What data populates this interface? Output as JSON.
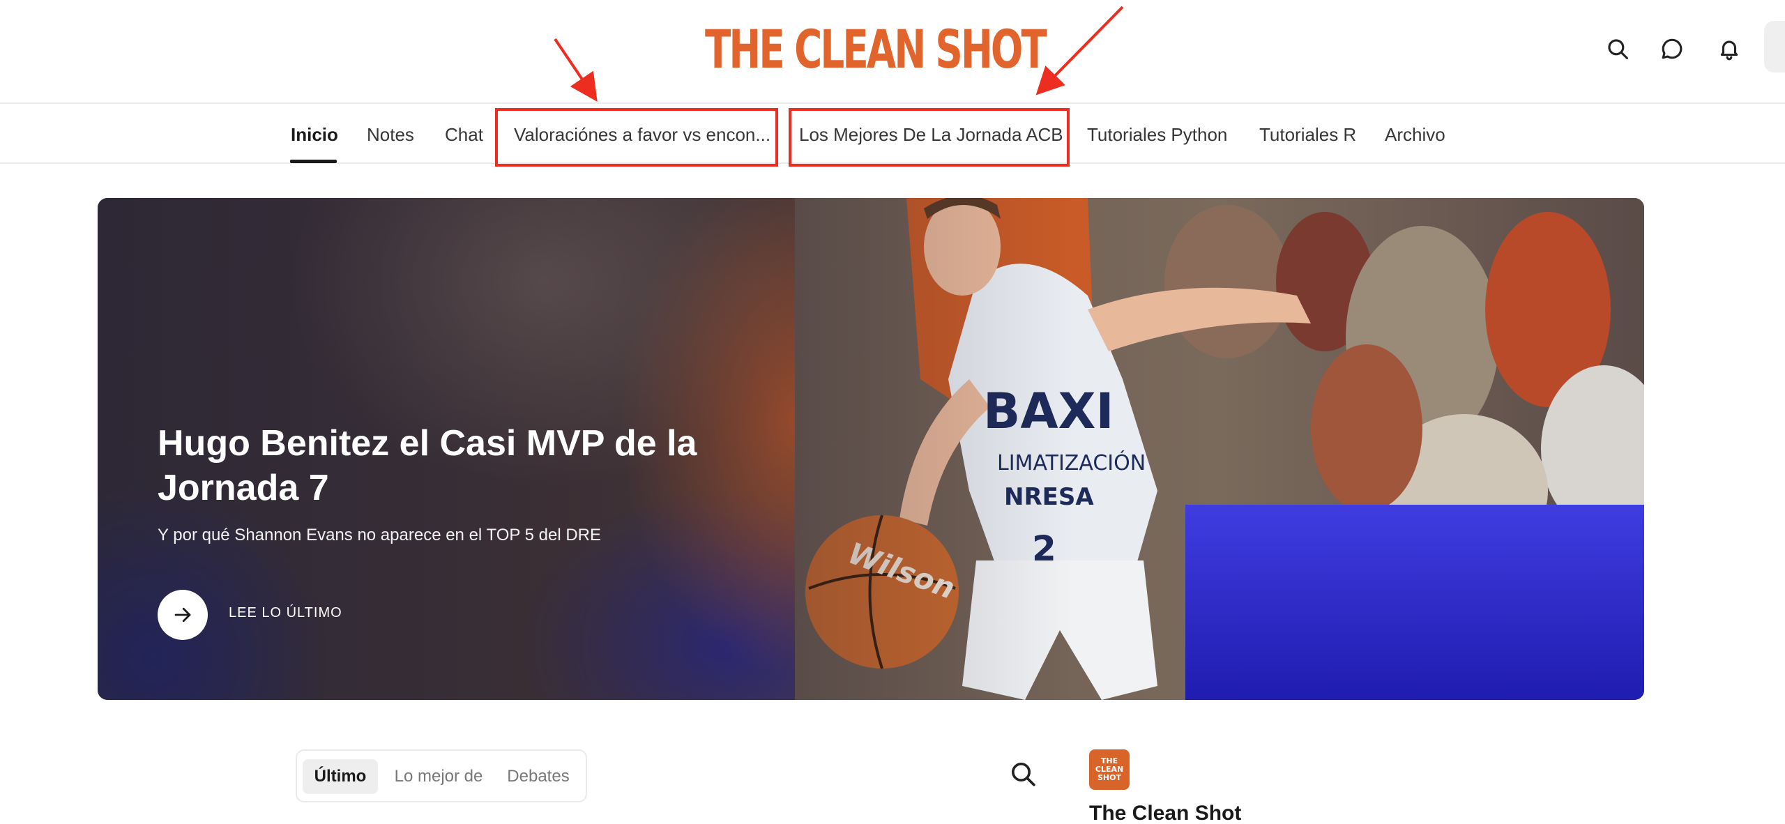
{
  "header": {
    "logo_text": "THE CLEAN SHOT",
    "icons": [
      "search-icon",
      "chat-bubble-icon",
      "bell-icon"
    ]
  },
  "nav": {
    "items": [
      {
        "label": "Inicio",
        "active": true
      },
      {
        "label": "Notes"
      },
      {
        "label": "Chat"
      },
      {
        "label": "Valoraciónes a favor vs encon..."
      },
      {
        "label": "Los Mejores De La Jornada ACB"
      },
      {
        "label": "Tutoriales Python"
      },
      {
        "label": "Tutoriales R"
      },
      {
        "label": "Archivo"
      }
    ]
  },
  "hero": {
    "title": "Hugo Benitez el Casi MVP de la Jornada 7",
    "subtitle": "Y por qué Shannon Evans no aparece en el TOP 5 del DRE",
    "cta_label": "LEE LO ÚLTIMO",
    "cta_icon": "arrow-right-icon"
  },
  "feed": {
    "tabs": [
      {
        "label": "Último",
        "active": true
      },
      {
        "label": "Lo mejor de"
      },
      {
        "label": "Debates"
      }
    ]
  },
  "publication": {
    "logo_lines": [
      "THE",
      "CLEAN",
      "SHOT"
    ],
    "name": "The Clean Shot"
  },
  "colors": {
    "brand": "#e0642b",
    "annotation": "#ec2d1f"
  }
}
